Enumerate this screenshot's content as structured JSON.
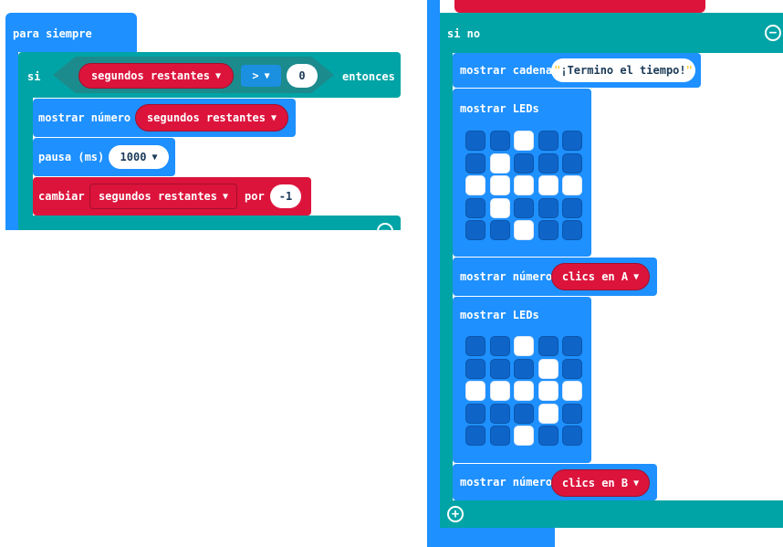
{
  "left": {
    "forever_label": "para siempre",
    "if_label": "si",
    "var1": "segundos restantes",
    "op": ">",
    "num_zero": "0",
    "then_label": "entonces",
    "show_number_label": "mostrar número",
    "var2": "segundos restantes",
    "pause_label": "pausa (ms)",
    "pause_value": "1000",
    "change_label": "cambiar",
    "var3": "segundos restantes",
    "by_label": "por",
    "change_value": "-1"
  },
  "right": {
    "else_label": "si no",
    "show_string_label": "mostrar cadena",
    "string_value": "¡Termino el tiempo!",
    "show_leds_label_1": "mostrar LEDs",
    "show_number_label_1": "mostrar número",
    "var_a": "clics en A",
    "show_leds_label_2": "mostrar LEDs",
    "show_number_label_2": "mostrar número",
    "var_b": "clics en B"
  },
  "leds": {
    "grid1": [
      [
        0,
        0,
        1,
        0,
        0
      ],
      [
        0,
        1,
        0,
        0,
        0
      ],
      [
        1,
        1,
        1,
        1,
        1
      ],
      [
        0,
        1,
        0,
        0,
        0
      ],
      [
        0,
        0,
        1,
        0,
        0
      ]
    ],
    "grid2": [
      [
        0,
        0,
        1,
        0,
        0
      ],
      [
        0,
        0,
        0,
        1,
        0
      ],
      [
        1,
        1,
        1,
        1,
        1
      ],
      [
        0,
        0,
        0,
        1,
        0
      ],
      [
        0,
        0,
        1,
        0,
        0
      ]
    ]
  },
  "colors": {
    "loops": "#1e90ff",
    "logic": "#00a4a6",
    "variables": "#dc143c",
    "led_on": "#ffffff",
    "led_off": "#0f64c8"
  }
}
